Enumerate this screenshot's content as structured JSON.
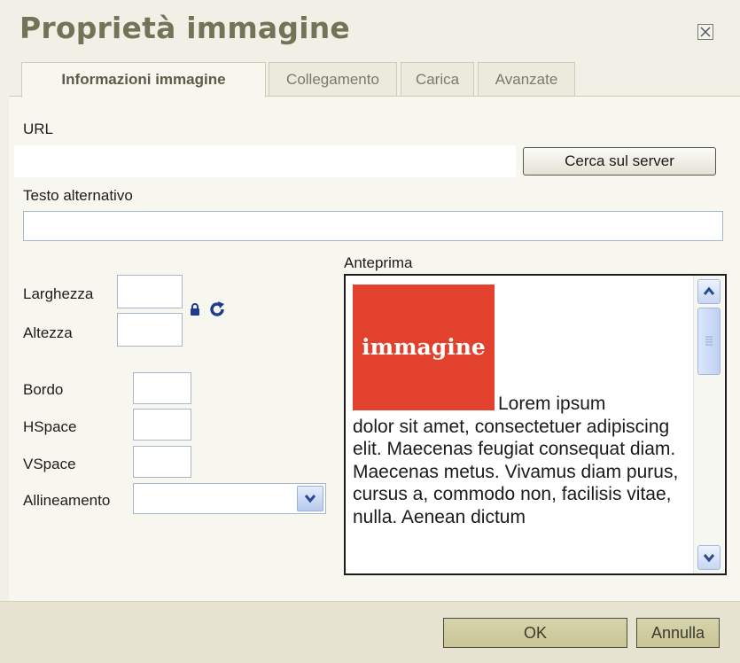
{
  "dialog": {
    "title": "Proprietà immagine",
    "close_icon": "close-icon"
  },
  "tabs": [
    {
      "label": "Informazioni immagine",
      "active": true
    },
    {
      "label": "Collegamento",
      "active": false
    },
    {
      "label": "Carica",
      "active": false
    },
    {
      "label": "Avanzate",
      "active": false
    }
  ],
  "form": {
    "url_label": "URL",
    "url_value": "",
    "browse_server_label": "Cerca sul server",
    "alt_label": "Testo alternativo",
    "alt_value": "",
    "width_label": "Larghezza",
    "width_value": "",
    "height_label": "Altezza",
    "height_value": "",
    "lock_icon": "lock-icon",
    "reset_icon": "reset-size-icon",
    "border_label": "Bordo",
    "border_value": "",
    "hspace_label": "HSpace",
    "hspace_value": "",
    "vspace_label": "VSpace",
    "vspace_value": "",
    "align_label": "Allineamento",
    "align_value": ""
  },
  "preview": {
    "label": "Anteprima",
    "image_text": "immagine",
    "text_first": "Lorem ipsum",
    "text_rest": "dolor sit amet, consectetuer adipiscing elit. Maecenas feugiat consequat diam. Maecenas metus. Vivamus diam purus, cursus a, commodo non, facilisis vitae, nulla. Aenean dictum"
  },
  "footer": {
    "ok_label": "OK",
    "cancel_label": "Annulla"
  },
  "colors": {
    "title": "#737357",
    "preview_image": "#e2412d",
    "footer": "#e6e4d1"
  }
}
